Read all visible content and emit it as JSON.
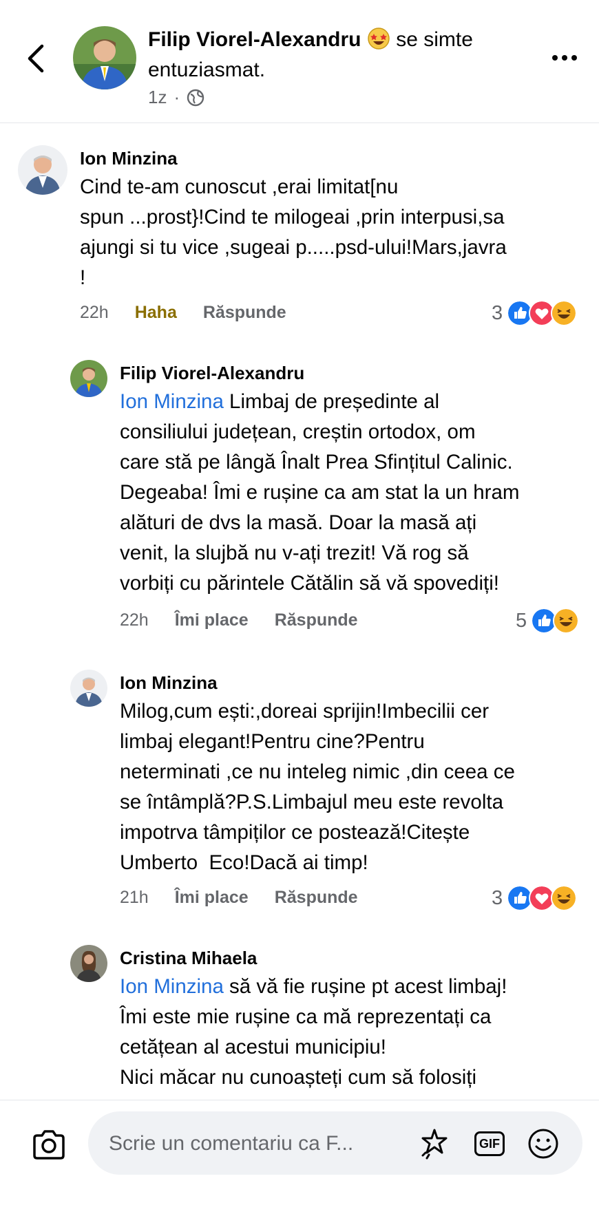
{
  "header": {
    "author": "Filip Viorel-Alexandru",
    "status_text": " se simte entuziasmat.",
    "time": "1z",
    "separator": "·",
    "privacy_icon": "globe-icon",
    "back_icon": "chevron-left-icon",
    "more_icon": "more-dots-icon"
  },
  "comments": [
    {
      "name": "Ion Minzina",
      "text": "Cind te-am cunoscut ,erai limitat[nu\nspun ...prost}!Cind te milogeai ,prin interpusi,sa\najungi si tu vice ,sugeai p.....psd-ului!Mars,javra\n!",
      "time": "22h",
      "action1": "Haha",
      "action2": "Răspunde",
      "reaction_count": "3"
    },
    {
      "name": "Filip Viorel-Alexandru",
      "mention": "Ion Minzina",
      "text": " Limbaj de președinte al\nconsiliului județean, creștin ortodox, om\ncare stă pe lângă Înalt Prea Sfințitul Calinic.\nDegeaba! Îmi e rușine ca am stat la un hram\nalături de dvs la masă. Doar la masă ați\nvenit, la slujbă nu v-ați trezit! Vă rog să\nvorbiți cu părintele Cătălin să vă spovediți!",
      "time": "22h",
      "action1": "Îmi place",
      "action2": "Răspunde",
      "reaction_count": "5"
    },
    {
      "name": "Ion Minzina",
      "text": "Milog,cum ești:,doreai sprijin!Imbecilii cer\nlimbaj elegant!Pentru cine?Pentru\nneterminati ,ce nu inteleg nimic ,din ceea ce\nse întâmplă?P.S.Limbajul meu este revolta\nimpotrva tâmpiților ce postează!Citește\nUmberto  Eco!Dacă ai timp!",
      "time": "21h",
      "action1": "Îmi place",
      "action2": "Răspunde",
      "reaction_count": "3"
    },
    {
      "name": "Cristina Mihaela",
      "mention": "Ion Minzina",
      "text": " să vă fie rușine pt acest limbaj!\nÎmi este mie rușine ca mă reprezentați ca\ncetățean al acestui municipiu!\nNici măcar nu cunoașteți cum să folosiți"
    }
  ],
  "composer": {
    "placeholder": "Scrie un comentariu ca F...",
    "gif_label": "GIF",
    "camera_icon": "camera-icon",
    "sticker_icon": "sticker-icon",
    "emoji_icon": "smiley-icon"
  },
  "colors": {
    "like": "#1877f2",
    "love": "#f33e58",
    "haha": "#f7b125",
    "mention": "#216fdb",
    "meta": "#65676b"
  }
}
